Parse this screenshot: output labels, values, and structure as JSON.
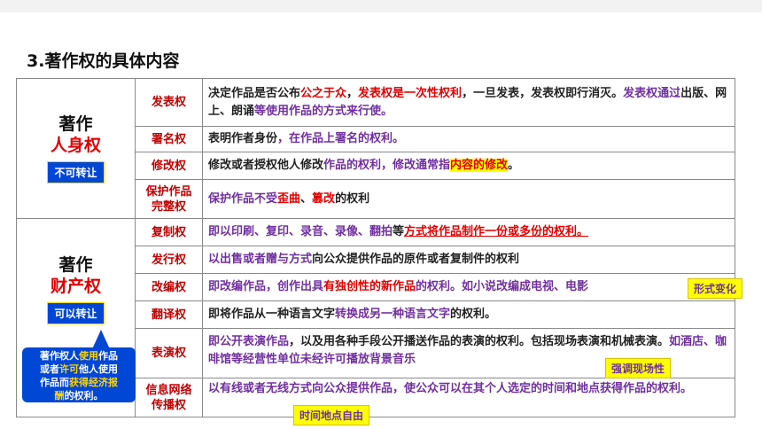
{
  "title": "3.著作权的具体内容",
  "personal": {
    "line1": "著作",
    "line2": "人身权",
    "badge": "不可转让",
    "rows": [
      {
        "name": "发表权",
        "desc": [
          {
            "t": "决定作品是否公布"
          },
          {
            "t": "公之于众",
            "c": "r"
          },
          {
            "t": "，"
          },
          {
            "t": "发表权是一次性权利",
            "c": "r"
          },
          {
            "t": "，一旦发表，发表权即行消灭。"
          },
          {
            "t": "发表权通过",
            "c": "p"
          },
          {
            "t": "出版、网上、朗诵"
          },
          {
            "t": "等使用作品的方式来行使。",
            "c": "p"
          }
        ]
      },
      {
        "name": "署名权",
        "desc": [
          {
            "t": "表明作者身份"
          },
          {
            "t": "，在作品上署名的权利。",
            "c": "p"
          }
        ]
      },
      {
        "name": "修改权",
        "desc": [
          {
            "t": "修改或者授权他人修改"
          },
          {
            "t": "作品的权利，修改通常指",
            "c": "p"
          },
          {
            "t": "内容的修改",
            "c": "r hl"
          },
          {
            "t": "。"
          }
        ]
      },
      {
        "name": "保护作品完整权",
        "desc": [
          {
            "t": "保护作品不受",
            "c": "p"
          },
          {
            "t": "歪曲",
            "c": "r"
          },
          {
            "t": "、"
          },
          {
            "t": "篡改",
            "c": "r"
          },
          {
            "t": "的权利"
          }
        ]
      }
    ]
  },
  "property": {
    "line1": "著作",
    "line2": "财产权",
    "badge": "可以转让",
    "rows": [
      {
        "name": "复制权",
        "desc": [
          {
            "t": "即以印刷、复印、录音、录像、翻拍",
            "c": "p"
          },
          {
            "t": "等"
          },
          {
            "t": "方式将作品制作一份或多份的权利。",
            "c": "r ul"
          }
        ]
      },
      {
        "name": "发行权",
        "desc": [
          {
            "t": "以出售或者赠与方式",
            "c": "p"
          },
          {
            "t": "向公众提供作品的原件或者复制件的权利"
          }
        ]
      },
      {
        "name": "改编权",
        "desc": [
          {
            "t": "即改编作品，创作出具",
            "c": "p"
          },
          {
            "t": "有独创性的新作品",
            "c": "r"
          },
          {
            "t": "的权利。如小说改编成电视、电影",
            "c": "p"
          }
        ]
      },
      {
        "name": "翻译权",
        "desc": [
          {
            "t": "即将作品从一种语言文字"
          },
          {
            "t": "转换成另一种语言文字",
            "c": "p"
          },
          {
            "t": "的权利。"
          }
        ]
      },
      {
        "name": "表演权",
        "desc": [
          {
            "t": "即公开表演作品",
            "c": "p"
          },
          {
            "t": "，以及用各种手段公开播送作品的表演的权利。包括现场表演和机械表演。"
          },
          {
            "t": "如酒店、咖啡馆等经营性单位未经许可播放背景音乐",
            "c": "p"
          }
        ]
      },
      {
        "name": "信息网络传播权",
        "desc": [
          {
            "t": "以有线或者无线方式向公众提供作品，使公众可以在其个人选定的时间和地点获得作品的权利。",
            "c": "p"
          }
        ]
      }
    ]
  },
  "notes": {
    "adapt": "形式变化",
    "perform": "强调现场性",
    "network": "时间地点自由"
  },
  "callout": {
    "segments": [
      {
        "t": "著作权人"
      },
      {
        "t": "使用",
        "c": "y"
      },
      {
        "t": "作品"
      },
      {
        "br": true
      },
      {
        "t": "或者"
      },
      {
        "t": "许可",
        "c": "y"
      },
      {
        "t": "他人使用"
      },
      {
        "br": true
      },
      {
        "t": "作品而"
      },
      {
        "t": "获得经济报",
        "c": "y"
      },
      {
        "br": true
      },
      {
        "t": "酬",
        "c": "y"
      },
      {
        "t": "的权利。"
      }
    ]
  }
}
